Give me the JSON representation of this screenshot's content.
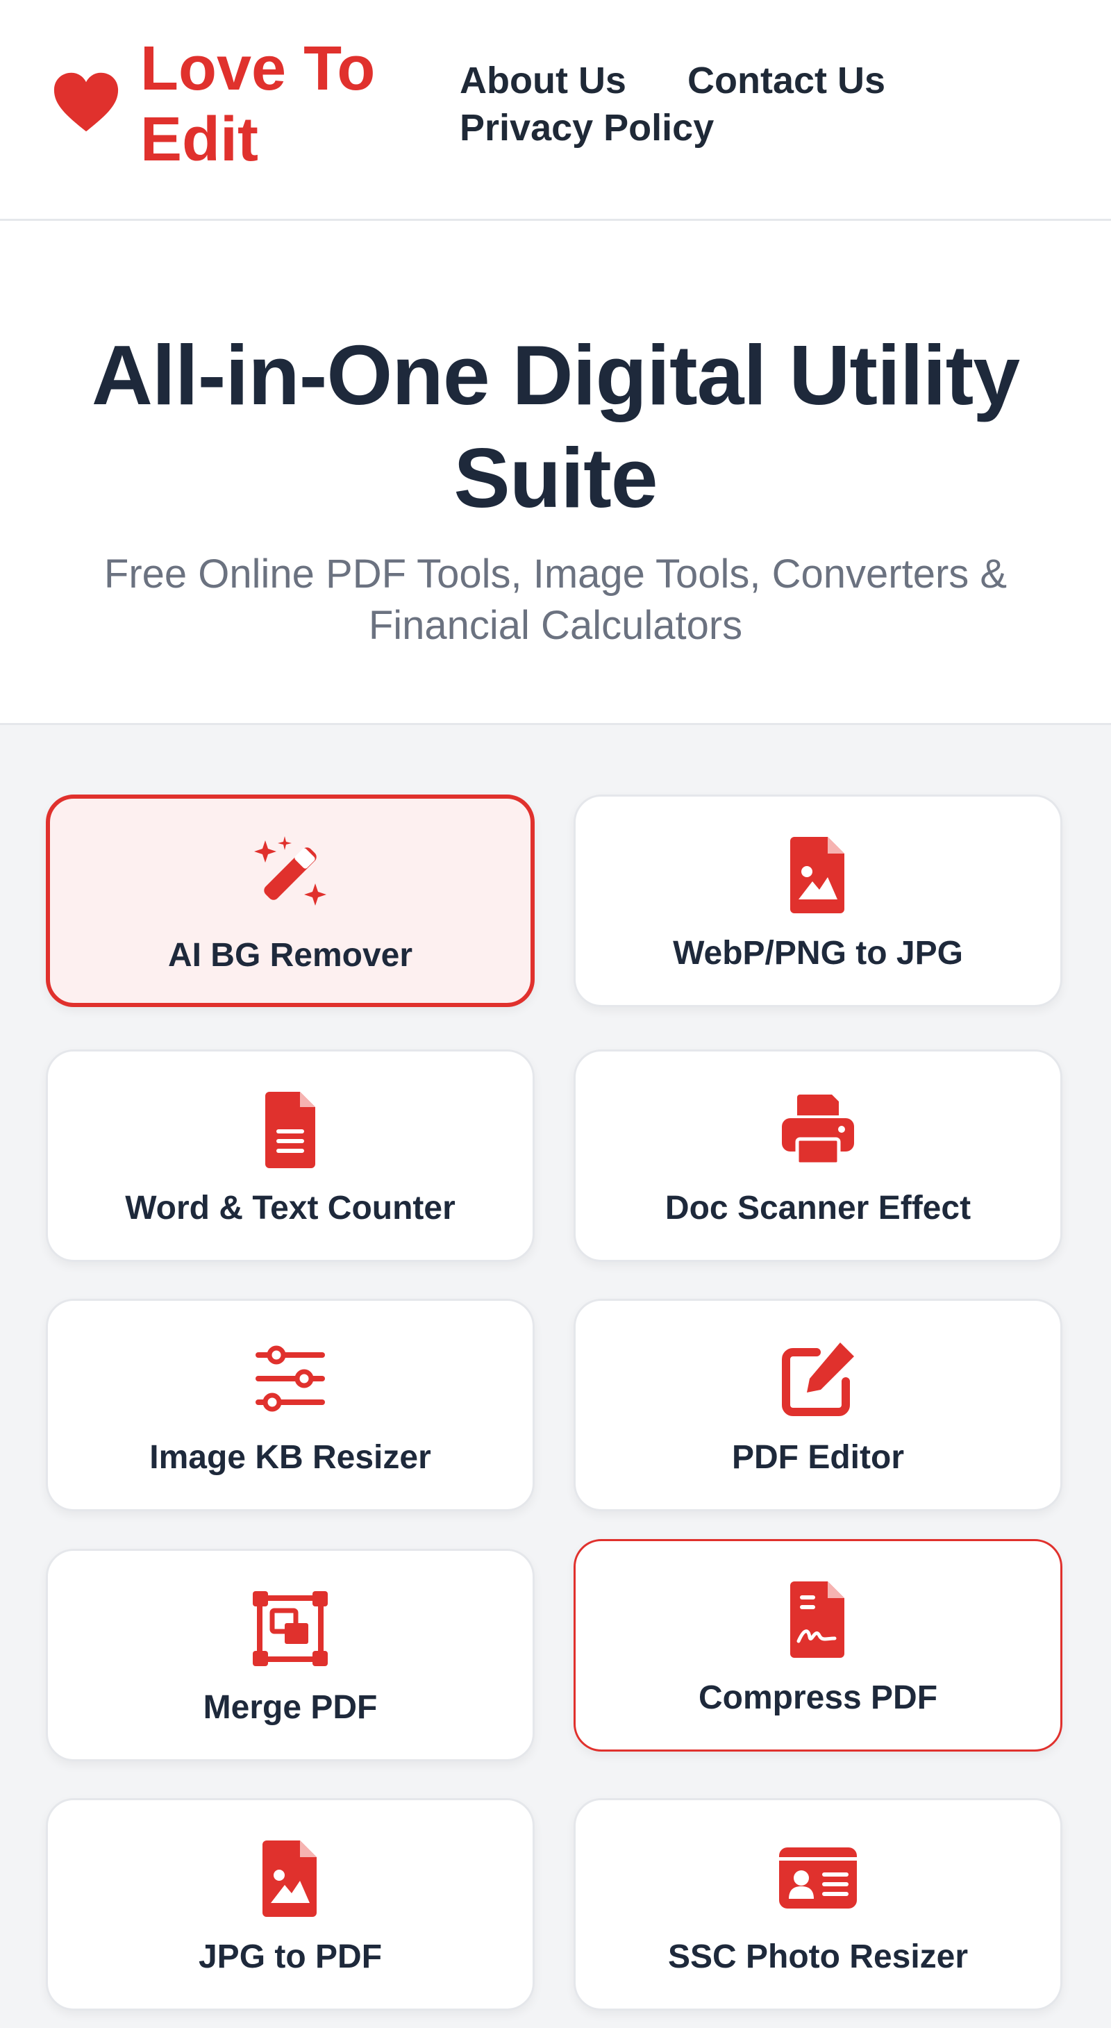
{
  "brand": {
    "name": "Love To Edit",
    "accent_color": "#e0312d",
    "logo_icon": "heart-icon"
  },
  "nav": {
    "about": "About Us",
    "contact": "Contact Us",
    "privacy": "Privacy Policy"
  },
  "hero": {
    "title": "All-in-One Digital Utility Suite",
    "subtitle": "Free Online PDF Tools, Image Tools, Converters & Financial Calculators"
  },
  "tools": [
    {
      "label": "AI BG Remover",
      "icon": "magic-wand-icon",
      "state": "active"
    },
    {
      "label": "WebP/PNG to JPG",
      "icon": "image-file-icon",
      "state": "default"
    },
    {
      "label": "Word & Text Counter",
      "icon": "text-file-icon",
      "state": "default"
    },
    {
      "label": "Doc Scanner Effect",
      "icon": "printer-icon",
      "state": "default"
    },
    {
      "label": "Image KB Resizer",
      "icon": "sliders-icon",
      "state": "default"
    },
    {
      "label": "PDF Editor",
      "icon": "edit-icon",
      "state": "default"
    },
    {
      "label": "Merge PDF",
      "icon": "object-group-icon",
      "state": "default"
    },
    {
      "label": "Compress PDF",
      "icon": "signature-file-icon",
      "state": "outlined"
    },
    {
      "label": "JPG to PDF",
      "icon": "image-file-icon",
      "state": "default"
    },
    {
      "label": "SSC Photo Resizer",
      "icon": "id-card-icon",
      "state": "default"
    }
  ]
}
